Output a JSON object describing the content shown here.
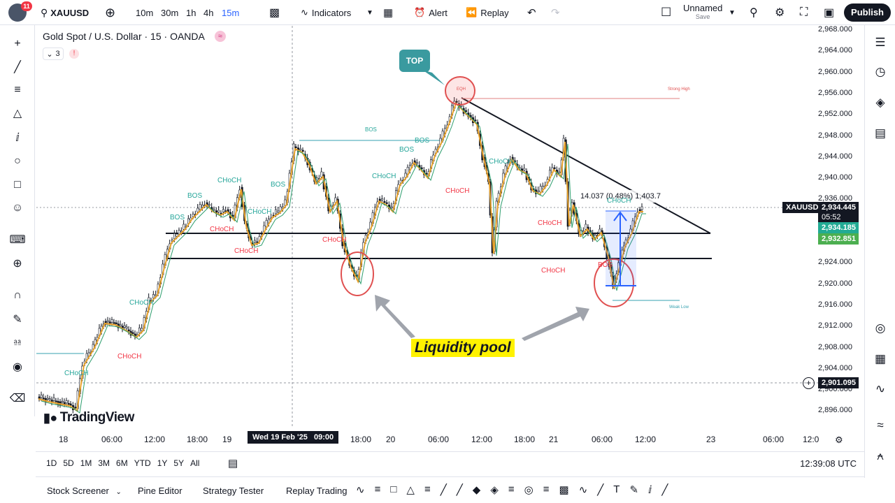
{
  "topbar": {
    "notifications": "11",
    "symbol": "XAUUSD",
    "intervals": [
      "10m",
      "30m",
      "1h",
      "4h",
      "15m"
    ],
    "active_interval": "15m",
    "indicators": "Indicators",
    "alert": "Alert",
    "replay": "Replay",
    "layout_name": "Unnamed",
    "layout_sub": "Save",
    "publish": "Publish"
  },
  "legend": {
    "title": "Gold Spot / U.S. Dollar · 15 · OANDA",
    "indicator_count": "3"
  },
  "price_scale": [
    "2,968.000",
    "2,964.000",
    "2,960.000",
    "2,956.000",
    "2,952.000",
    "2,948.000",
    "2,944.000",
    "2,940.000",
    "2,936.000",
    "2,932.000",
    "2,928.000",
    "2,924.000",
    "2,920.000",
    "2,916.000",
    "2,912.000",
    "2,908.000",
    "2,904.000",
    "2,900.000",
    "2,896.000"
  ],
  "price_tags": {
    "symbol": "XAUUSD",
    "last": "2,934.445",
    "countdown": "05:52",
    "green1": "2,934.185",
    "green2": "2,932.851",
    "crosshair": "2,901.095"
  },
  "time_axis": [
    "18",
    "06:00",
    "12:00",
    "18:00",
    "19",
    "Wed 19 Feb '25   09:00",
    "18:00",
    "20",
    "06:00",
    "12:00",
    "18:00",
    "21",
    "06:00",
    "12:00",
    "23",
    "06:00",
    "12:0"
  ],
  "annotations": {
    "top": "TOP",
    "liquidity": "Liquidity pool",
    "measure": "14.037 (0.48%) 1,403.7",
    "strong_high": "Strong High",
    "weak_low": "Weak Low",
    "eqh": "EQH",
    "labels": [
      "BOS",
      "BOS",
      "BOS",
      "BOS",
      "BOS",
      "BOS",
      "CHoCH",
      "CHoCH",
      "CHoCH",
      "CHoCH",
      "CHoCH",
      "CHoCH",
      "CHoCH",
      "CHoCH",
      "CHoCH",
      "CHoCH",
      "CHoCH",
      "CHoCH",
      "CHoCH"
    ]
  },
  "bottom": {
    "ranges": [
      "1D",
      "5D",
      "1M",
      "3M",
      "6M",
      "YTD",
      "1Y",
      "5Y",
      "All"
    ],
    "time": "12:39:08 UTC"
  },
  "footer": {
    "tabs": [
      "Stock Screener",
      "Pine Editor",
      "Strategy Tester",
      "Replay Trading"
    ]
  },
  "branding": "TradingView"
}
